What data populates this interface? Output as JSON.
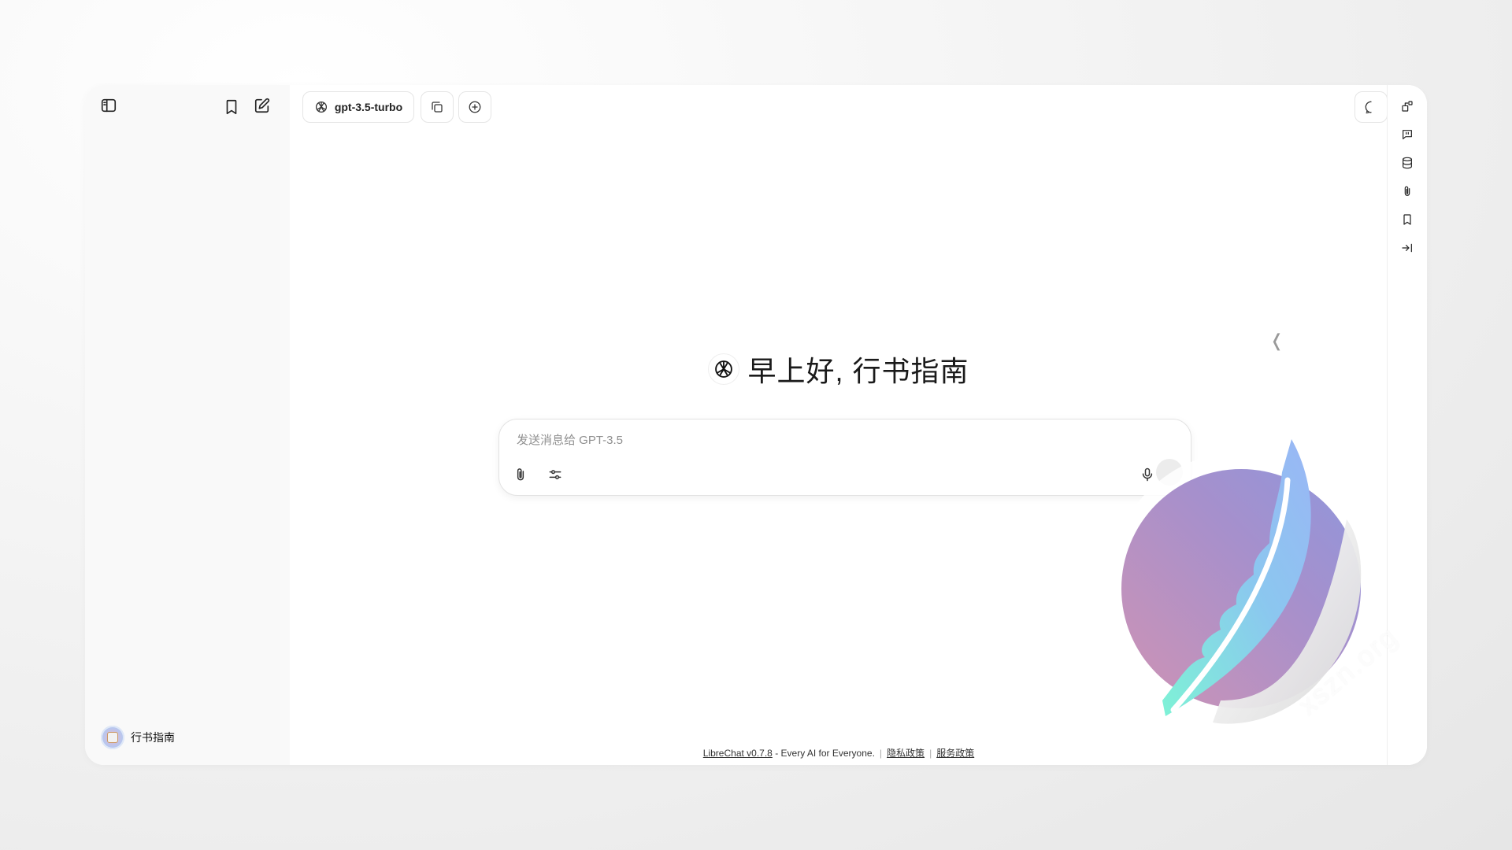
{
  "model": {
    "label": "gpt-3.5-turbo"
  },
  "greeting": {
    "text": "早上好, 行书指南"
  },
  "composer": {
    "placeholder": "发送消息给 GPT-3.5"
  },
  "user": {
    "name": "行书指南"
  },
  "footer": {
    "brand_link": "LibreChat v0.7.8",
    "tagline": " - Every AI for Everyone.",
    "privacy_link": "隐私政策",
    "terms_link": "服务政策",
    "separator": "|"
  },
  "watermark": {
    "text": "xszn.org"
  },
  "icons": {
    "sidebar_toggle": "sidebar-toggle-icon",
    "bookmark": "bookmark-icon",
    "new_chat": "edit-icon",
    "model": "openai-icon",
    "copy": "copy-icon",
    "add": "plus-circle-icon",
    "temporary_chat": "chat-bubble-dashed-icon",
    "attach": "paperclip-icon",
    "settings": "sliders-icon",
    "mic": "mic-icon",
    "rail": [
      "apps-icon",
      "prompt-icon",
      "database-icon",
      "paperclip-icon",
      "bookmark-icon",
      "collapse-right-icon"
    ]
  },
  "colors": {
    "background": "#f1f1f1",
    "sidebar": "#f9f9f9",
    "accent": "#111111"
  }
}
